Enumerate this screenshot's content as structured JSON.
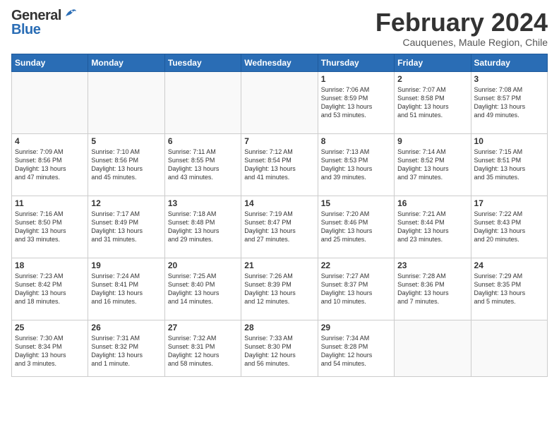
{
  "header": {
    "title": "February 2024",
    "location": "Cauquenes, Maule Region, Chile",
    "logo_general": "General",
    "logo_blue": "Blue"
  },
  "days_of_week": [
    "Sunday",
    "Monday",
    "Tuesday",
    "Wednesday",
    "Thursday",
    "Friday",
    "Saturday"
  ],
  "weeks": [
    [
      {
        "num": "",
        "info": ""
      },
      {
        "num": "",
        "info": ""
      },
      {
        "num": "",
        "info": ""
      },
      {
        "num": "",
        "info": ""
      },
      {
        "num": "1",
        "info": "Sunrise: 7:06 AM\nSunset: 8:59 PM\nDaylight: 13 hours\nand 53 minutes."
      },
      {
        "num": "2",
        "info": "Sunrise: 7:07 AM\nSunset: 8:58 PM\nDaylight: 13 hours\nand 51 minutes."
      },
      {
        "num": "3",
        "info": "Sunrise: 7:08 AM\nSunset: 8:57 PM\nDaylight: 13 hours\nand 49 minutes."
      }
    ],
    [
      {
        "num": "4",
        "info": "Sunrise: 7:09 AM\nSunset: 8:56 PM\nDaylight: 13 hours\nand 47 minutes."
      },
      {
        "num": "5",
        "info": "Sunrise: 7:10 AM\nSunset: 8:56 PM\nDaylight: 13 hours\nand 45 minutes."
      },
      {
        "num": "6",
        "info": "Sunrise: 7:11 AM\nSunset: 8:55 PM\nDaylight: 13 hours\nand 43 minutes."
      },
      {
        "num": "7",
        "info": "Sunrise: 7:12 AM\nSunset: 8:54 PM\nDaylight: 13 hours\nand 41 minutes."
      },
      {
        "num": "8",
        "info": "Sunrise: 7:13 AM\nSunset: 8:53 PM\nDaylight: 13 hours\nand 39 minutes."
      },
      {
        "num": "9",
        "info": "Sunrise: 7:14 AM\nSunset: 8:52 PM\nDaylight: 13 hours\nand 37 minutes."
      },
      {
        "num": "10",
        "info": "Sunrise: 7:15 AM\nSunset: 8:51 PM\nDaylight: 13 hours\nand 35 minutes."
      }
    ],
    [
      {
        "num": "11",
        "info": "Sunrise: 7:16 AM\nSunset: 8:50 PM\nDaylight: 13 hours\nand 33 minutes."
      },
      {
        "num": "12",
        "info": "Sunrise: 7:17 AM\nSunset: 8:49 PM\nDaylight: 13 hours\nand 31 minutes."
      },
      {
        "num": "13",
        "info": "Sunrise: 7:18 AM\nSunset: 8:48 PM\nDaylight: 13 hours\nand 29 minutes."
      },
      {
        "num": "14",
        "info": "Sunrise: 7:19 AM\nSunset: 8:47 PM\nDaylight: 13 hours\nand 27 minutes."
      },
      {
        "num": "15",
        "info": "Sunrise: 7:20 AM\nSunset: 8:46 PM\nDaylight: 13 hours\nand 25 minutes."
      },
      {
        "num": "16",
        "info": "Sunrise: 7:21 AM\nSunset: 8:44 PM\nDaylight: 13 hours\nand 23 minutes."
      },
      {
        "num": "17",
        "info": "Sunrise: 7:22 AM\nSunset: 8:43 PM\nDaylight: 13 hours\nand 20 minutes."
      }
    ],
    [
      {
        "num": "18",
        "info": "Sunrise: 7:23 AM\nSunset: 8:42 PM\nDaylight: 13 hours\nand 18 minutes."
      },
      {
        "num": "19",
        "info": "Sunrise: 7:24 AM\nSunset: 8:41 PM\nDaylight: 13 hours\nand 16 minutes."
      },
      {
        "num": "20",
        "info": "Sunrise: 7:25 AM\nSunset: 8:40 PM\nDaylight: 13 hours\nand 14 minutes."
      },
      {
        "num": "21",
        "info": "Sunrise: 7:26 AM\nSunset: 8:39 PM\nDaylight: 13 hours\nand 12 minutes."
      },
      {
        "num": "22",
        "info": "Sunrise: 7:27 AM\nSunset: 8:37 PM\nDaylight: 13 hours\nand 10 minutes."
      },
      {
        "num": "23",
        "info": "Sunrise: 7:28 AM\nSunset: 8:36 PM\nDaylight: 13 hours\nand 7 minutes."
      },
      {
        "num": "24",
        "info": "Sunrise: 7:29 AM\nSunset: 8:35 PM\nDaylight: 13 hours\nand 5 minutes."
      }
    ],
    [
      {
        "num": "25",
        "info": "Sunrise: 7:30 AM\nSunset: 8:34 PM\nDaylight: 13 hours\nand 3 minutes."
      },
      {
        "num": "26",
        "info": "Sunrise: 7:31 AM\nSunset: 8:32 PM\nDaylight: 13 hours\nand 1 minute."
      },
      {
        "num": "27",
        "info": "Sunrise: 7:32 AM\nSunset: 8:31 PM\nDaylight: 12 hours\nand 58 minutes."
      },
      {
        "num": "28",
        "info": "Sunrise: 7:33 AM\nSunset: 8:30 PM\nDaylight: 12 hours\nand 56 minutes."
      },
      {
        "num": "29",
        "info": "Sunrise: 7:34 AM\nSunset: 8:28 PM\nDaylight: 12 hours\nand 54 minutes."
      },
      {
        "num": "",
        "info": ""
      },
      {
        "num": "",
        "info": ""
      }
    ]
  ]
}
